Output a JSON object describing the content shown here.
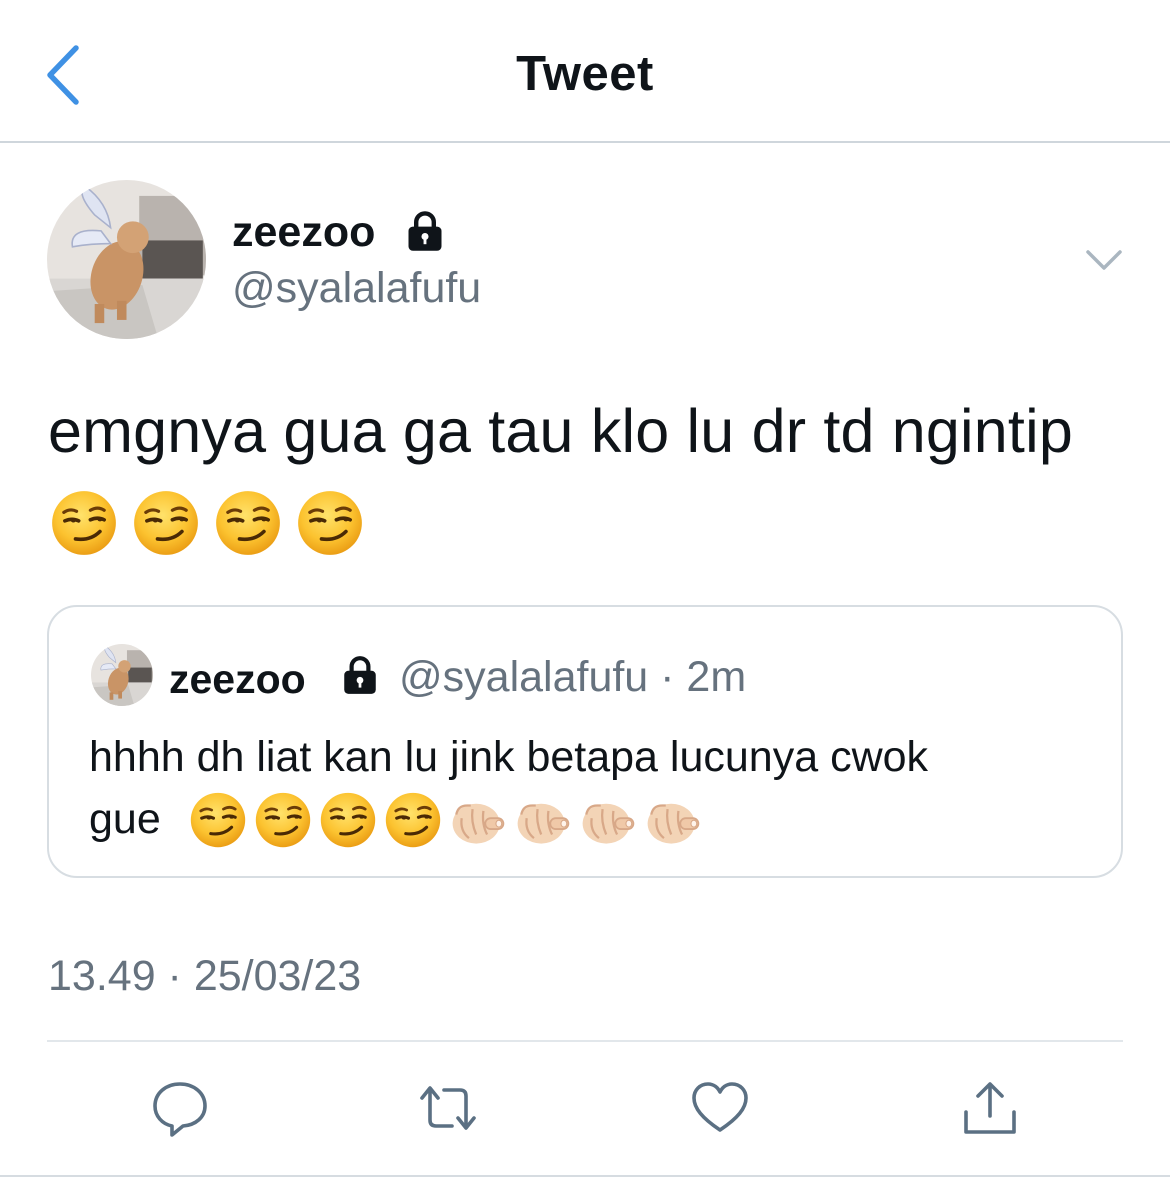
{
  "header": {
    "title": "Tweet",
    "back_icon": "chevron-left-icon",
    "accent": "#3f91e4"
  },
  "tweet": {
    "author": {
      "name": "zeezoo",
      "handle": "@syalalafufu",
      "protected_icon": "lock-icon"
    },
    "text": "emgnya gua ga tau klo lu dr td ngintip",
    "emojis": [
      "smirk",
      "smirk",
      "smirk",
      "smirk"
    ],
    "more_icon": "chevron-down-icon",
    "timestamp": "13.49 · 25/03/23"
  },
  "quoted_tweet": {
    "author": {
      "name": "zeezoo",
      "handle": "@syalalafufu",
      "time": "2m",
      "protected_icon": "lock-icon"
    },
    "handle_time": "@syalalafufu · 2m",
    "text_line1": "hhhh dh liat kan lu jink betapa lucunya cwok",
    "text_line2": "gue",
    "emojis": [
      "smirk",
      "smirk",
      "smirk",
      "smirk",
      "point",
      "point",
      "point",
      "point"
    ]
  },
  "actions": [
    {
      "icon": "reply-icon"
    },
    {
      "icon": "retweet-icon"
    },
    {
      "icon": "like-icon"
    },
    {
      "icon": "share-icon"
    }
  ],
  "colors": {
    "text": "#0f1419",
    "secondary": "#66727e",
    "border": "#d7dde2",
    "icon": "#5b7083"
  }
}
